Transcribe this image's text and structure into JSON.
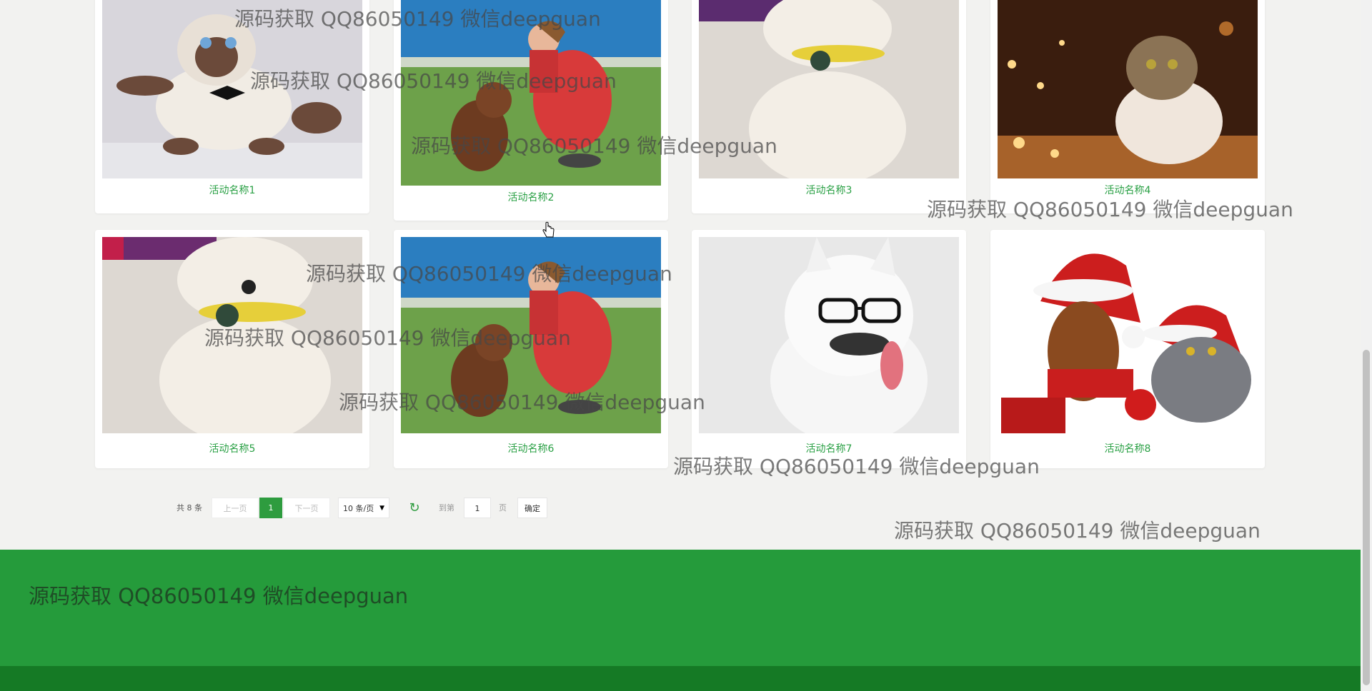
{
  "activities": [
    {
      "title": "活动名称1",
      "image": "siamese-cat-bowtie"
    },
    {
      "title": "活动名称2",
      "image": "woman-with-poodle"
    },
    {
      "title": "活动名称3",
      "image": "white-poodle"
    },
    {
      "title": "活动名称4",
      "image": "cat-with-lights"
    },
    {
      "title": "活动名称5",
      "image": "white-poodle"
    },
    {
      "title": "活动名称6",
      "image": "woman-with-poodle"
    },
    {
      "title": "活动名称7",
      "image": "husky-with-glasses"
    },
    {
      "title": "活动名称8",
      "image": "christmas-dog-and-cat"
    }
  ],
  "pagination": {
    "total_text": "共 8 条",
    "prev_label": "上一页",
    "current_page": "1",
    "next_label": "下一页",
    "page_size": "10 条/页",
    "goto_label": "到第",
    "goto_value": "1",
    "page_unit": "页",
    "confirm_label": "确定"
  },
  "watermark": "源码获取 QQ86050149 微信deepguan",
  "colors": {
    "accent": "#2aa045",
    "footer": "#259b3b",
    "footer_bottom": "#157a25",
    "page_bg": "#f2f2f0"
  }
}
